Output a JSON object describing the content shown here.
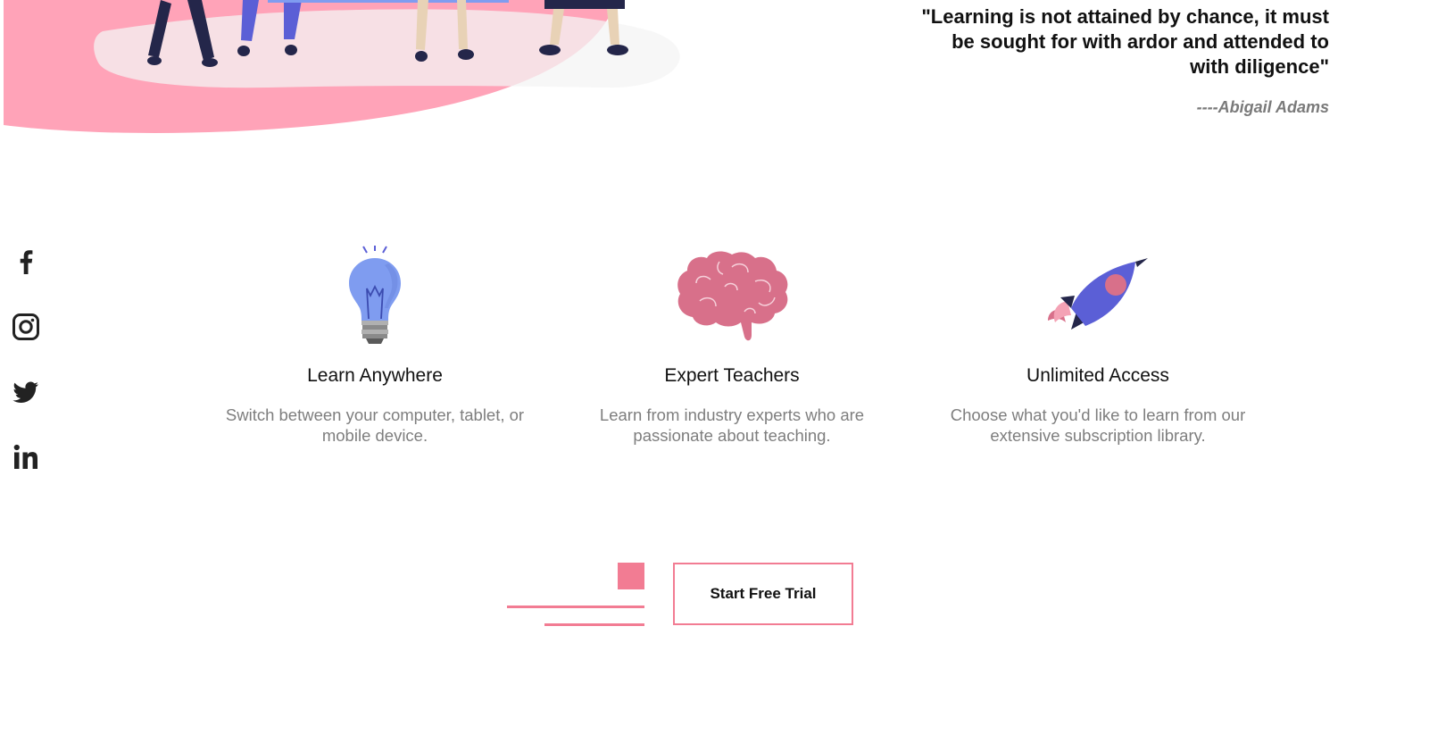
{
  "colors": {
    "accent_pink": "#f27c93",
    "hero_pink": "#ffa3b8",
    "bulb_blue": "#7f9cf0",
    "brain_pink": "#d8708a",
    "rocket_purple": "#5b5fd6",
    "navy": "#24264a"
  },
  "quote": {
    "text": "\"Learning is not attained by chance, it must be sought for with ardor and attended to with diligence\"",
    "author": "----Abigail Adams"
  },
  "social": [
    {
      "name": "facebook",
      "icon": "facebook-icon"
    },
    {
      "name": "instagram",
      "icon": "instagram-icon"
    },
    {
      "name": "twitter",
      "icon": "twitter-icon"
    },
    {
      "name": "linkedin",
      "icon": "linkedin-icon"
    }
  ],
  "features": [
    {
      "icon": "lightbulb-icon",
      "title": "Learn Anywhere",
      "description": "Switch between your computer, tablet, or mobile device."
    },
    {
      "icon": "brain-icon",
      "title": "Expert Teachers",
      "description": "Learn from industry experts who are passionate about teaching."
    },
    {
      "icon": "rocket-icon",
      "title": "Unlimited Access",
      "description": "Choose what you'd like to learn from our extensive subscription library."
    }
  ],
  "cta": {
    "label": "Start Free Trial"
  }
}
